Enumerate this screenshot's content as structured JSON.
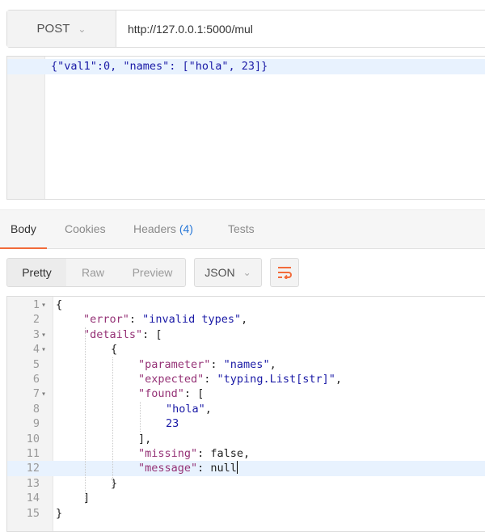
{
  "request": {
    "method": "POST",
    "url": "http://127.0.0.1:5000/mul",
    "body_line_number": "1",
    "body_text": "{\"val1\":0, \"names\": [\"hola\", 23]}"
  },
  "response_tabs": {
    "body": "Body",
    "cookies": "Cookies",
    "headers": "Headers",
    "headers_count": "(4)",
    "tests": "Tests"
  },
  "view_modes": {
    "pretty": "Pretty",
    "raw": "Raw",
    "preview": "Preview"
  },
  "format": {
    "selected": "JSON"
  },
  "icons": {
    "dropdown": "chevron-down-icon",
    "wrap": "wrap-lines-icon"
  },
  "colors": {
    "accent": "#f26b3a",
    "key": "#953276",
    "string": "#1a1aa6",
    "highlight": "#e8f2fe"
  },
  "response_body": {
    "lines": [
      {
        "n": "1",
        "fold": true,
        "indent": 0,
        "parts": [
          {
            "t": "{",
            "c": "p"
          }
        ]
      },
      {
        "n": "2",
        "fold": false,
        "indent": 1,
        "parts": [
          {
            "t": "\"error\"",
            "c": "k"
          },
          {
            "t": ": ",
            "c": "p"
          },
          {
            "t": "\"invalid types\"",
            "c": "s"
          },
          {
            "t": ",",
            "c": "p"
          }
        ]
      },
      {
        "n": "3",
        "fold": true,
        "indent": 1,
        "parts": [
          {
            "t": "\"details\"",
            "c": "k"
          },
          {
            "t": ": [",
            "c": "p"
          }
        ]
      },
      {
        "n": "4",
        "fold": true,
        "indent": 2,
        "parts": [
          {
            "t": "{",
            "c": "p"
          }
        ]
      },
      {
        "n": "5",
        "fold": false,
        "indent": 3,
        "parts": [
          {
            "t": "\"parameter\"",
            "c": "k"
          },
          {
            "t": ": ",
            "c": "p"
          },
          {
            "t": "\"names\"",
            "c": "s"
          },
          {
            "t": ",",
            "c": "p"
          }
        ]
      },
      {
        "n": "6",
        "fold": false,
        "indent": 3,
        "parts": [
          {
            "t": "\"expected\"",
            "c": "k"
          },
          {
            "t": ": ",
            "c": "p"
          },
          {
            "t": "\"typing.List[str]\"",
            "c": "s"
          },
          {
            "t": ",",
            "c": "p"
          }
        ]
      },
      {
        "n": "7",
        "fold": true,
        "indent": 3,
        "parts": [
          {
            "t": "\"found\"",
            "c": "k"
          },
          {
            "t": ": [",
            "c": "p"
          }
        ]
      },
      {
        "n": "8",
        "fold": false,
        "indent": 4,
        "parts": [
          {
            "t": "\"hola\"",
            "c": "s"
          },
          {
            "t": ",",
            "c": "p"
          }
        ]
      },
      {
        "n": "9",
        "fold": false,
        "indent": 4,
        "parts": [
          {
            "t": "23",
            "c": "s"
          }
        ]
      },
      {
        "n": "10",
        "fold": false,
        "indent": 3,
        "parts": [
          {
            "t": "],",
            "c": "p"
          }
        ]
      },
      {
        "n": "11",
        "fold": false,
        "indent": 3,
        "parts": [
          {
            "t": "\"missing\"",
            "c": "k"
          },
          {
            "t": ": false,",
            "c": "c"
          }
        ]
      },
      {
        "n": "12",
        "fold": false,
        "indent": 3,
        "highlight": true,
        "parts": [
          {
            "t": "\"message\"",
            "c": "k"
          },
          {
            "t": ": null",
            "c": "c"
          }
        ]
      },
      {
        "n": "13",
        "fold": false,
        "indent": 2,
        "parts": [
          {
            "t": "}",
            "c": "p"
          }
        ]
      },
      {
        "n": "14",
        "fold": false,
        "indent": 1,
        "parts": [
          {
            "t": "]",
            "c": "p"
          }
        ]
      },
      {
        "n": "15",
        "fold": false,
        "indent": 0,
        "parts": [
          {
            "t": "}",
            "c": "p"
          }
        ]
      }
    ]
  }
}
